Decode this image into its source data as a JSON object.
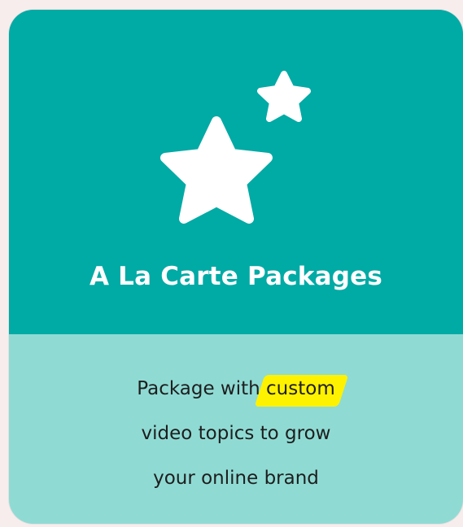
{
  "card": {
    "title": "A La Carte Packages",
    "icon": "two-stars-icon",
    "description": {
      "line1_prefix": "Package with ",
      "line1_highlight": "custom",
      "line2": "video topics to grow",
      "line3": "your online brand"
    }
  },
  "colors": {
    "top_background": "#00aaa5",
    "bottom_background": "#8fdbd4",
    "highlight": "#fff200",
    "title_text": "#ffffff",
    "body_text": "#1e1e1e"
  }
}
